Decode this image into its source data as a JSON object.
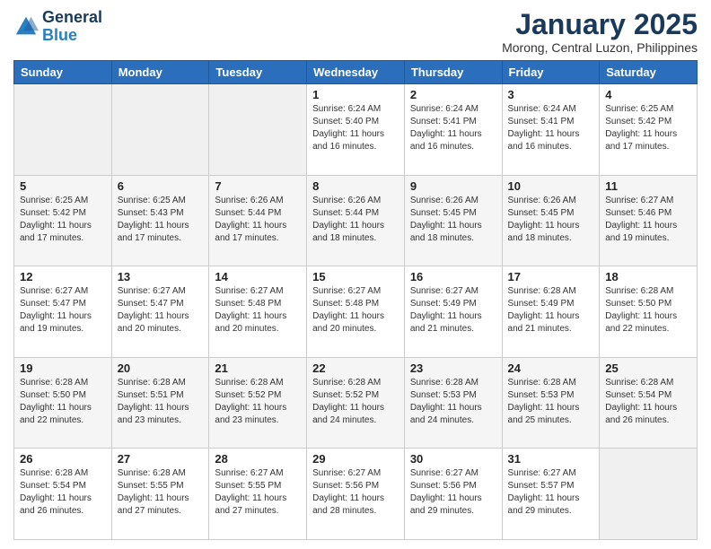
{
  "header": {
    "logo_line1": "General",
    "logo_line2": "Blue",
    "month_title": "January 2025",
    "location": "Morong, Central Luzon, Philippines"
  },
  "weekdays": [
    "Sunday",
    "Monday",
    "Tuesday",
    "Wednesday",
    "Thursday",
    "Friday",
    "Saturday"
  ],
  "weeks": [
    [
      {
        "day": "",
        "sunrise": "",
        "sunset": "",
        "daylight": ""
      },
      {
        "day": "",
        "sunrise": "",
        "sunset": "",
        "daylight": ""
      },
      {
        "day": "",
        "sunrise": "",
        "sunset": "",
        "daylight": ""
      },
      {
        "day": "1",
        "sunrise": "6:24 AM",
        "sunset": "5:40 PM",
        "daylight": "11 hours and 16 minutes."
      },
      {
        "day": "2",
        "sunrise": "6:24 AM",
        "sunset": "5:41 PM",
        "daylight": "11 hours and 16 minutes."
      },
      {
        "day": "3",
        "sunrise": "6:24 AM",
        "sunset": "5:41 PM",
        "daylight": "11 hours and 16 minutes."
      },
      {
        "day": "4",
        "sunrise": "6:25 AM",
        "sunset": "5:42 PM",
        "daylight": "11 hours and 17 minutes."
      }
    ],
    [
      {
        "day": "5",
        "sunrise": "6:25 AM",
        "sunset": "5:42 PM",
        "daylight": "11 hours and 17 minutes."
      },
      {
        "day": "6",
        "sunrise": "6:25 AM",
        "sunset": "5:43 PM",
        "daylight": "11 hours and 17 minutes."
      },
      {
        "day": "7",
        "sunrise": "6:26 AM",
        "sunset": "5:44 PM",
        "daylight": "11 hours and 17 minutes."
      },
      {
        "day": "8",
        "sunrise": "6:26 AM",
        "sunset": "5:44 PM",
        "daylight": "11 hours and 18 minutes."
      },
      {
        "day": "9",
        "sunrise": "6:26 AM",
        "sunset": "5:45 PM",
        "daylight": "11 hours and 18 minutes."
      },
      {
        "day": "10",
        "sunrise": "6:26 AM",
        "sunset": "5:45 PM",
        "daylight": "11 hours and 18 minutes."
      },
      {
        "day": "11",
        "sunrise": "6:27 AM",
        "sunset": "5:46 PM",
        "daylight": "11 hours and 19 minutes."
      }
    ],
    [
      {
        "day": "12",
        "sunrise": "6:27 AM",
        "sunset": "5:47 PM",
        "daylight": "11 hours and 19 minutes."
      },
      {
        "day": "13",
        "sunrise": "6:27 AM",
        "sunset": "5:47 PM",
        "daylight": "11 hours and 20 minutes."
      },
      {
        "day": "14",
        "sunrise": "6:27 AM",
        "sunset": "5:48 PM",
        "daylight": "11 hours and 20 minutes."
      },
      {
        "day": "15",
        "sunrise": "6:27 AM",
        "sunset": "5:48 PM",
        "daylight": "11 hours and 20 minutes."
      },
      {
        "day": "16",
        "sunrise": "6:27 AM",
        "sunset": "5:49 PM",
        "daylight": "11 hours and 21 minutes."
      },
      {
        "day": "17",
        "sunrise": "6:28 AM",
        "sunset": "5:49 PM",
        "daylight": "11 hours and 21 minutes."
      },
      {
        "day": "18",
        "sunrise": "6:28 AM",
        "sunset": "5:50 PM",
        "daylight": "11 hours and 22 minutes."
      }
    ],
    [
      {
        "day": "19",
        "sunrise": "6:28 AM",
        "sunset": "5:50 PM",
        "daylight": "11 hours and 22 minutes."
      },
      {
        "day": "20",
        "sunrise": "6:28 AM",
        "sunset": "5:51 PM",
        "daylight": "11 hours and 23 minutes."
      },
      {
        "day": "21",
        "sunrise": "6:28 AM",
        "sunset": "5:52 PM",
        "daylight": "11 hours and 23 minutes."
      },
      {
        "day": "22",
        "sunrise": "6:28 AM",
        "sunset": "5:52 PM",
        "daylight": "11 hours and 24 minutes."
      },
      {
        "day": "23",
        "sunrise": "6:28 AM",
        "sunset": "5:53 PM",
        "daylight": "11 hours and 24 minutes."
      },
      {
        "day": "24",
        "sunrise": "6:28 AM",
        "sunset": "5:53 PM",
        "daylight": "11 hours and 25 minutes."
      },
      {
        "day": "25",
        "sunrise": "6:28 AM",
        "sunset": "5:54 PM",
        "daylight": "11 hours and 26 minutes."
      }
    ],
    [
      {
        "day": "26",
        "sunrise": "6:28 AM",
        "sunset": "5:54 PM",
        "daylight": "11 hours and 26 minutes."
      },
      {
        "day": "27",
        "sunrise": "6:28 AM",
        "sunset": "5:55 PM",
        "daylight": "11 hours and 27 minutes."
      },
      {
        "day": "28",
        "sunrise": "6:27 AM",
        "sunset": "5:55 PM",
        "daylight": "11 hours and 27 minutes."
      },
      {
        "day": "29",
        "sunrise": "6:27 AM",
        "sunset": "5:56 PM",
        "daylight": "11 hours and 28 minutes."
      },
      {
        "day": "30",
        "sunrise": "6:27 AM",
        "sunset": "5:56 PM",
        "daylight": "11 hours and 29 minutes."
      },
      {
        "day": "31",
        "sunrise": "6:27 AM",
        "sunset": "5:57 PM",
        "daylight": "11 hours and 29 minutes."
      },
      {
        "day": "",
        "sunrise": "",
        "sunset": "",
        "daylight": ""
      }
    ]
  ]
}
